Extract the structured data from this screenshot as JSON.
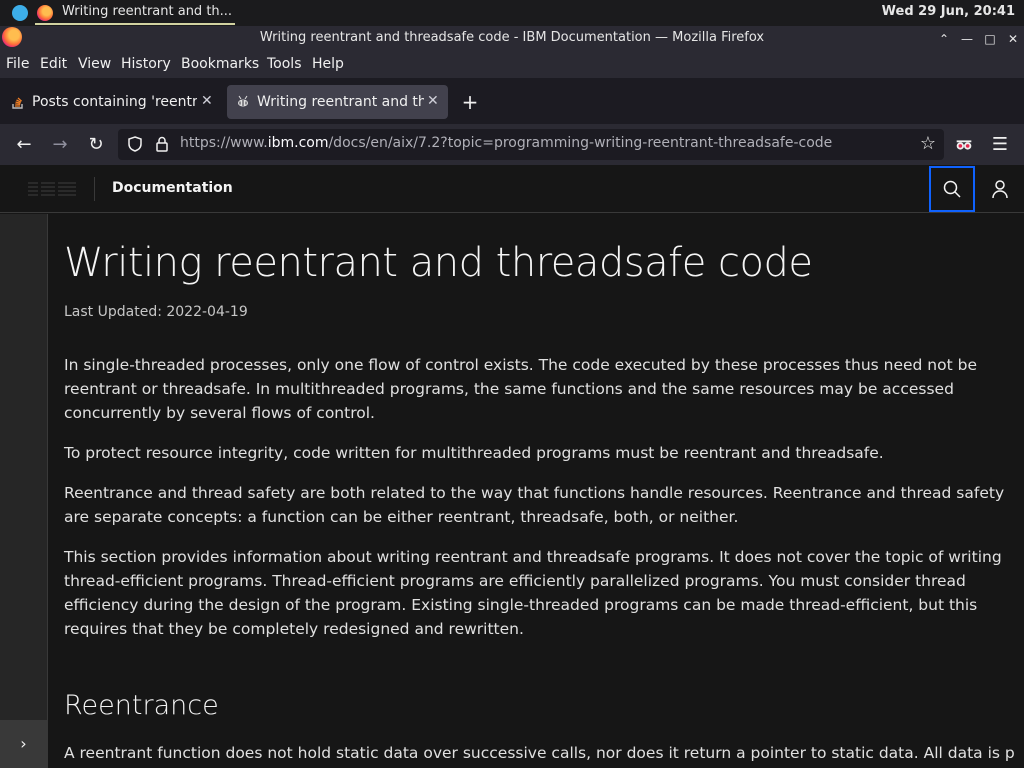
{
  "system_bar": {
    "task_label": "Writing reentrant and th...",
    "clock": "Wed 29 Jun, 20:41"
  },
  "window": {
    "title": "Writing reentrant and threadsafe code - IBM Documentation — Mozilla Firefox"
  },
  "menu": {
    "items": [
      "File",
      "Edit",
      "View",
      "History",
      "Bookmarks",
      "Tools",
      "Help"
    ]
  },
  "tabs": [
    {
      "label": "Posts containing 'reentrant'",
      "active": false
    },
    {
      "label": "Writing reentrant and thr",
      "active": true
    }
  ],
  "urlbar": {
    "url_prefix": "https://www.",
    "url_domain": "ibm.com",
    "url_path": "/docs/en/aix/7.2?topic=programming-writing-reentrant-threadsafe-code"
  },
  "ibm_header": {
    "section": "Documentation"
  },
  "article": {
    "title": "Writing reentrant and threadsafe code",
    "last_updated": "Last Updated: 2022-04-19",
    "paragraphs": [
      "In single-threaded processes, only one flow of control exists. The code executed by these processes thus need not be reentrant or threadsafe. In multithreaded programs, the same functions and the same resources may be accessed concurrently by several flows of control.",
      "To protect resource integrity, code written for multithreaded programs must be reentrant and threadsafe.",
      "Reentrance and thread safety are both related to the way that functions handle resources. Reentrance and thread safety are separate concepts: a function can be either reentrant, threadsafe, both, or neither.",
      "This section provides information about writing reentrant and threadsafe programs. It does not cover the topic of writing thread-efficient programs. Thread-efficient programs are efficiently parallelized programs. You must consider thread efficiency during the design of the program. Existing single-threaded programs can be made thread-efficient, but this requires that they be completely redesigned and rewritten."
    ],
    "section_heading": "Reentrance",
    "section_paragraph": "A reentrant function does not hold static data over successive calls, nor does it return a pointer to static data. All data is provided by"
  },
  "colors": {
    "focus_outline": "#0f62fe",
    "page_bg": "#161616",
    "rail_bg": "#262626"
  }
}
